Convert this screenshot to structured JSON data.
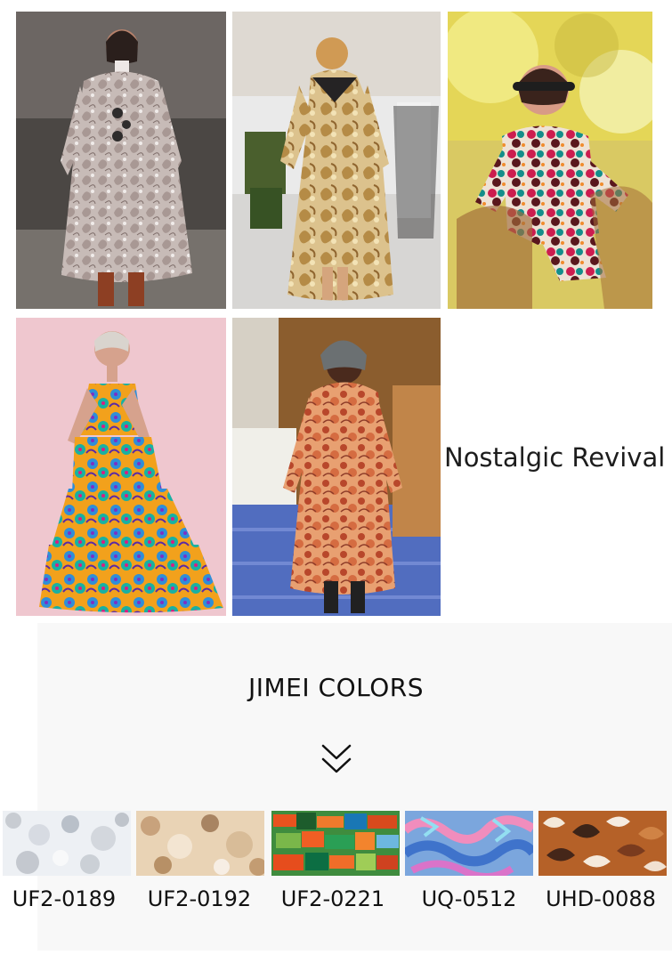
{
  "page": {
    "tagline": "Nostalgic Revival",
    "brand_title": "JIMEI COLORS"
  },
  "photos": [
    {
      "name": "photo-paisley-dress-runway",
      "accent": "#b9aba6"
    },
    {
      "name": "photo-gold-brocade-coat-runway",
      "accent": "#cfa86a"
    },
    {
      "name": "photo-geometric-print-outfit",
      "accent": "#d9b84a"
    },
    {
      "name": "photo-floral-tiered-dress",
      "accent": "#f0c8d0"
    },
    {
      "name": "photo-orange-floral-dress-runway",
      "accent": "#c87552"
    }
  ],
  "swatches": [
    {
      "code": "UF2-0189",
      "icon": "fabric-swatch-gray-white"
    },
    {
      "code": "UF2-0192",
      "icon": "fabric-swatch-beige"
    },
    {
      "code": "UF2-0221",
      "icon": "fabric-swatch-orange-green"
    },
    {
      "code": "UQ-0512",
      "icon": "fabric-swatch-blue-pink"
    },
    {
      "code": "UHD-0088",
      "icon": "fabric-swatch-brown-leaf"
    }
  ]
}
